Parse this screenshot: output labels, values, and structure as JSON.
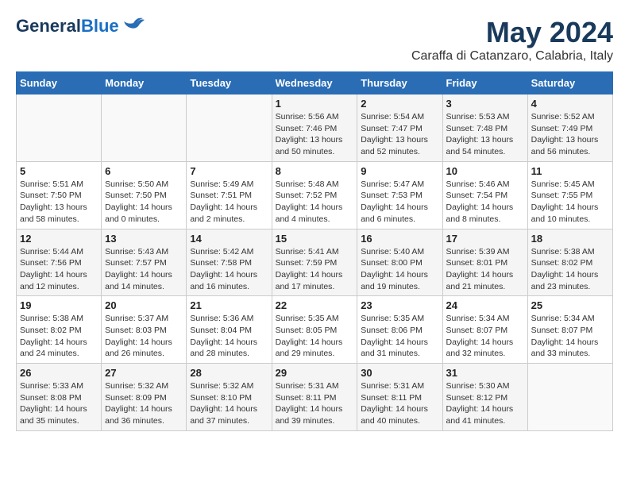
{
  "header": {
    "logo_general": "General",
    "logo_blue": "Blue",
    "month_year": "May 2024",
    "location": "Caraffa di Catanzaro, Calabria, Italy"
  },
  "days_of_week": [
    "Sunday",
    "Monday",
    "Tuesday",
    "Wednesday",
    "Thursday",
    "Friday",
    "Saturday"
  ],
  "weeks": [
    [
      {
        "day": "",
        "info": ""
      },
      {
        "day": "",
        "info": ""
      },
      {
        "day": "",
        "info": ""
      },
      {
        "day": "1",
        "info": "Sunrise: 5:56 AM\nSunset: 7:46 PM\nDaylight: 13 hours\nand 50 minutes."
      },
      {
        "day": "2",
        "info": "Sunrise: 5:54 AM\nSunset: 7:47 PM\nDaylight: 13 hours\nand 52 minutes."
      },
      {
        "day": "3",
        "info": "Sunrise: 5:53 AM\nSunset: 7:48 PM\nDaylight: 13 hours\nand 54 minutes."
      },
      {
        "day": "4",
        "info": "Sunrise: 5:52 AM\nSunset: 7:49 PM\nDaylight: 13 hours\nand 56 minutes."
      }
    ],
    [
      {
        "day": "5",
        "info": "Sunrise: 5:51 AM\nSunset: 7:50 PM\nDaylight: 13 hours\nand 58 minutes."
      },
      {
        "day": "6",
        "info": "Sunrise: 5:50 AM\nSunset: 7:50 PM\nDaylight: 14 hours\nand 0 minutes."
      },
      {
        "day": "7",
        "info": "Sunrise: 5:49 AM\nSunset: 7:51 PM\nDaylight: 14 hours\nand 2 minutes."
      },
      {
        "day": "8",
        "info": "Sunrise: 5:48 AM\nSunset: 7:52 PM\nDaylight: 14 hours\nand 4 minutes."
      },
      {
        "day": "9",
        "info": "Sunrise: 5:47 AM\nSunset: 7:53 PM\nDaylight: 14 hours\nand 6 minutes."
      },
      {
        "day": "10",
        "info": "Sunrise: 5:46 AM\nSunset: 7:54 PM\nDaylight: 14 hours\nand 8 minutes."
      },
      {
        "day": "11",
        "info": "Sunrise: 5:45 AM\nSunset: 7:55 PM\nDaylight: 14 hours\nand 10 minutes."
      }
    ],
    [
      {
        "day": "12",
        "info": "Sunrise: 5:44 AM\nSunset: 7:56 PM\nDaylight: 14 hours\nand 12 minutes."
      },
      {
        "day": "13",
        "info": "Sunrise: 5:43 AM\nSunset: 7:57 PM\nDaylight: 14 hours\nand 14 minutes."
      },
      {
        "day": "14",
        "info": "Sunrise: 5:42 AM\nSunset: 7:58 PM\nDaylight: 14 hours\nand 16 minutes."
      },
      {
        "day": "15",
        "info": "Sunrise: 5:41 AM\nSunset: 7:59 PM\nDaylight: 14 hours\nand 17 minutes."
      },
      {
        "day": "16",
        "info": "Sunrise: 5:40 AM\nSunset: 8:00 PM\nDaylight: 14 hours\nand 19 minutes."
      },
      {
        "day": "17",
        "info": "Sunrise: 5:39 AM\nSunset: 8:01 PM\nDaylight: 14 hours\nand 21 minutes."
      },
      {
        "day": "18",
        "info": "Sunrise: 5:38 AM\nSunset: 8:02 PM\nDaylight: 14 hours\nand 23 minutes."
      }
    ],
    [
      {
        "day": "19",
        "info": "Sunrise: 5:38 AM\nSunset: 8:02 PM\nDaylight: 14 hours\nand 24 minutes."
      },
      {
        "day": "20",
        "info": "Sunrise: 5:37 AM\nSunset: 8:03 PM\nDaylight: 14 hours\nand 26 minutes."
      },
      {
        "day": "21",
        "info": "Sunrise: 5:36 AM\nSunset: 8:04 PM\nDaylight: 14 hours\nand 28 minutes."
      },
      {
        "day": "22",
        "info": "Sunrise: 5:35 AM\nSunset: 8:05 PM\nDaylight: 14 hours\nand 29 minutes."
      },
      {
        "day": "23",
        "info": "Sunrise: 5:35 AM\nSunset: 8:06 PM\nDaylight: 14 hours\nand 31 minutes."
      },
      {
        "day": "24",
        "info": "Sunrise: 5:34 AM\nSunset: 8:07 PM\nDaylight: 14 hours\nand 32 minutes."
      },
      {
        "day": "25",
        "info": "Sunrise: 5:34 AM\nSunset: 8:07 PM\nDaylight: 14 hours\nand 33 minutes."
      }
    ],
    [
      {
        "day": "26",
        "info": "Sunrise: 5:33 AM\nSunset: 8:08 PM\nDaylight: 14 hours\nand 35 minutes."
      },
      {
        "day": "27",
        "info": "Sunrise: 5:32 AM\nSunset: 8:09 PM\nDaylight: 14 hours\nand 36 minutes."
      },
      {
        "day": "28",
        "info": "Sunrise: 5:32 AM\nSunset: 8:10 PM\nDaylight: 14 hours\nand 37 minutes."
      },
      {
        "day": "29",
        "info": "Sunrise: 5:31 AM\nSunset: 8:11 PM\nDaylight: 14 hours\nand 39 minutes."
      },
      {
        "day": "30",
        "info": "Sunrise: 5:31 AM\nSunset: 8:11 PM\nDaylight: 14 hours\nand 40 minutes."
      },
      {
        "day": "31",
        "info": "Sunrise: 5:30 AM\nSunset: 8:12 PM\nDaylight: 14 hours\nand 41 minutes."
      },
      {
        "day": "",
        "info": ""
      }
    ]
  ]
}
